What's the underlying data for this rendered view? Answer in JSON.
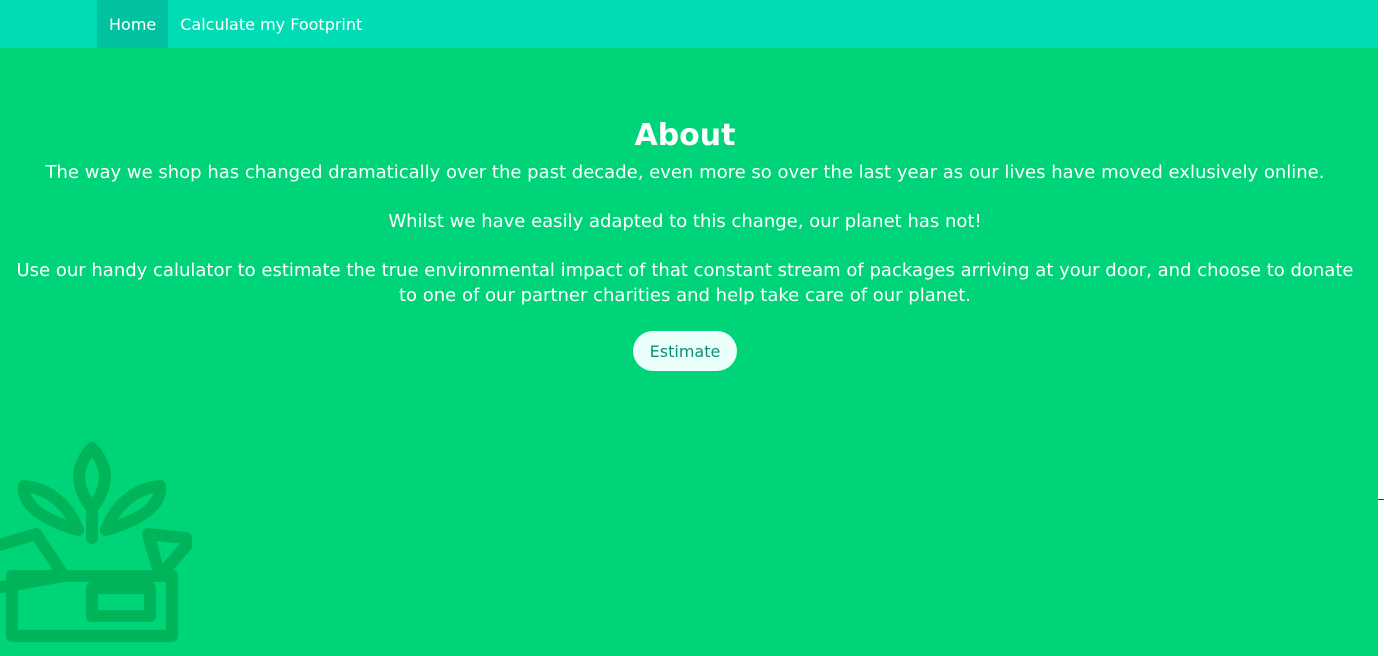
{
  "nav": {
    "items": [
      {
        "label": "Home",
        "active": true
      },
      {
        "label": "Calculate my Footprint",
        "active": false
      }
    ]
  },
  "about": {
    "title": "About",
    "paragraphs": [
      "The way we shop has changed dramatically over the past decade, even more so over the last year as our lives have moved exlusively online.",
      "Whilst we have easily adapted to this change, our planet has not!",
      "Use our handy calulator to estimate the true environmental impact of that constant stream of packages arriving at your door, and choose to donate to one of our partner charities and help take care of our planet."
    ],
    "button_label": "Estimate"
  },
  "decor": {
    "icon": "plant-in-box-icon"
  },
  "colors": {
    "nav_bg": "#00dcb4",
    "nav_active_bg": "#00c29e",
    "main_bg": "#00d478",
    "button_bg": "#eafff9",
    "button_text": "#0a8f74",
    "icon_color": "#00b45a"
  }
}
